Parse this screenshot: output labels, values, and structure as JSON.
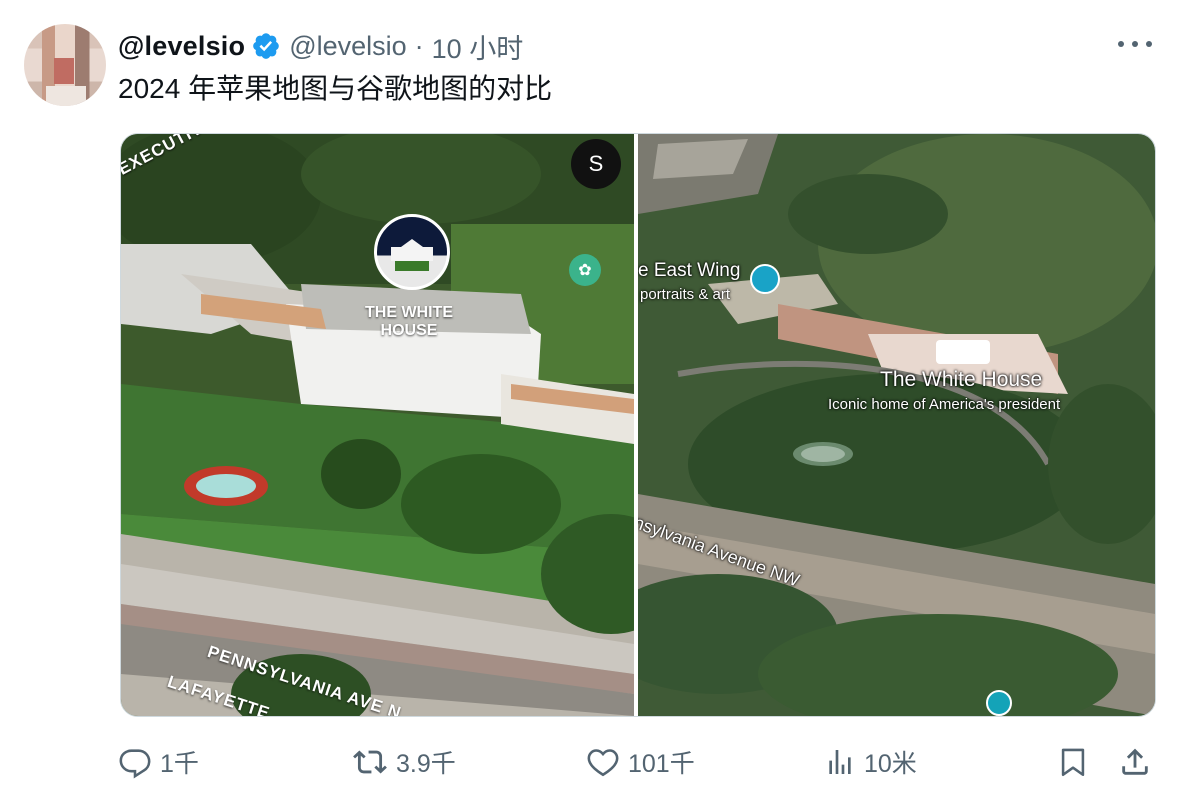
{
  "tweet": {
    "display_name": "@levelsio",
    "handle": "@levelsio",
    "separator": "·",
    "time": "10 小时",
    "text": "2024 年苹果地图与谷歌地图的对比"
  },
  "media": {
    "left_map": {
      "street_top": "EXECUTIVE AVE NW",
      "place_label": "THE WHITE HOUSE",
      "street_bottom1": "PENNSYLVANIA AVE N",
      "street_bottom2": "LAFAYETTE",
      "compass": "S"
    },
    "right_map": {
      "east_wing": "e East Wing",
      "east_wing_sub": "portraits & art",
      "place_label": "The White House",
      "place_sub": "Iconic home of America's president",
      "street": "nsylvania Avenue NW"
    }
  },
  "actions": {
    "reply_count": "1千",
    "retweet_count": "3.9千",
    "like_count": "101千",
    "views_count": "10米"
  },
  "colors": {
    "verified": "#1d9bf0",
    "text_secondary": "#536471",
    "text_primary": "#0f1419"
  }
}
